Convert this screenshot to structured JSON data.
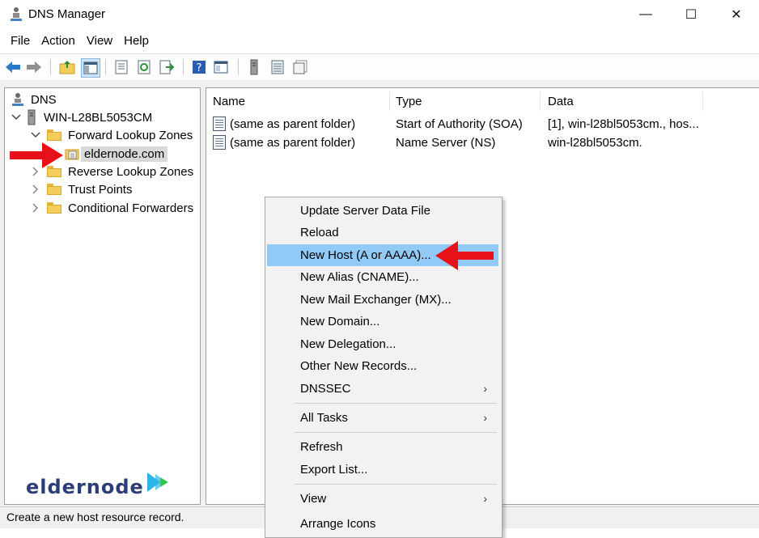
{
  "window": {
    "title": "DNS Manager",
    "controls": {
      "minimize": "—",
      "maximize": "☐",
      "close": "✕"
    }
  },
  "menu": [
    "File",
    "Action",
    "View",
    "Help"
  ],
  "toolbar": {
    "icons": [
      "back-arrow-icon",
      "forward-arrow-icon",
      "up-folder-icon",
      "show-hide-tree-icon",
      "properties-icon",
      "refresh-icon",
      "export-list-icon",
      "help-icon",
      "console-icon",
      "server-icon",
      "zone-list-icon",
      "records-icon"
    ]
  },
  "tree": {
    "root": "DNS",
    "server": "WIN-L28BL5053CM",
    "forward": "Forward Lookup Zones",
    "zone": "eldernode.com",
    "reverse": "Reverse Lookup Zones",
    "trust": "Trust Points",
    "conditional": "Conditional Forwarders"
  },
  "list": {
    "columns": [
      "Name",
      "Type",
      "Data"
    ],
    "rows": [
      {
        "name": "(same as parent folder)",
        "type": "Start of Authority (SOA)",
        "data": "[1], win-l28bl5053cm., hos..."
      },
      {
        "name": "(same as parent folder)",
        "type": "Name Server (NS)",
        "data": "win-l28bl5053cm."
      }
    ]
  },
  "context_menu": {
    "items": [
      "Update Server Data File",
      "Reload",
      "New Host (A or AAAA)...",
      "New Alias (CNAME)...",
      "New Mail Exchanger (MX)...",
      "New Domain...",
      "New Delegation...",
      "Other New Records...",
      "DNSSEC",
      "All Tasks",
      "Refresh",
      "Export List...",
      "View",
      "Arrange Icons"
    ],
    "submenu_glyph": "›",
    "highlighted": "New Host (A or AAAA)..."
  },
  "status": "Create a new host resource record.",
  "logo": "eldernode",
  "colors": {
    "highlight": "#91c9f7",
    "arrow": "#e8111a",
    "logo_text": "#2c3e75",
    "logo_accent": "#2ab6e8"
  }
}
